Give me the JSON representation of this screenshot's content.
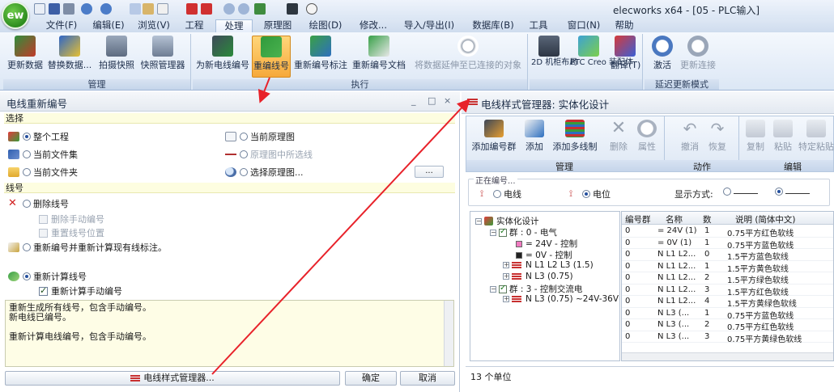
{
  "app": {
    "logo_text": "ew",
    "window_title": "elecworks x64 - [05 - PLC输入]"
  },
  "menu_tabs": [
    "文件(F)",
    "编辑(E)",
    "浏览(V)",
    "工程",
    "处理",
    "原理图",
    "绘图(D)",
    "修改...",
    "导入/导出(I)",
    "数据库(B)",
    "工具",
    "窗口(N)",
    "帮助"
  ],
  "ribbon": {
    "groups": [
      {
        "label": "管理",
        "buttons": [
          "更新数据",
          "替换数据...",
          "拍摄快照",
          "快照管理器"
        ]
      },
      {
        "label": "执行",
        "buttons": [
          "为新电线编号",
          "重编线号",
          "重新编号标注",
          "重新编号文档",
          "将数据延伸至已连接的对象"
        ]
      },
      {
        "label": "",
        "buttons": [
          "2D 机柜布局",
          "PTC Creo 装配体",
          "翻译(T)"
        ]
      },
      {
        "label": "延迟更新模式",
        "buttons": [
          "激活",
          "更新连接"
        ]
      }
    ]
  },
  "renumber_panel": {
    "title": "电线重新编号",
    "win_controls": [
      "_",
      "□",
      "×"
    ],
    "select_section": "选择",
    "scope_options": [
      "整个工程",
      "当前文件集",
      "当前文件夹"
    ],
    "scope_options_right": [
      "当前原理图",
      "原理图中所选线",
      "选择原理图..."
    ],
    "browse_label": "...",
    "wire_section": "线号",
    "delete_label": "删除线号",
    "delete_manual": "删除手动编号",
    "reset_pos": "重置线号位置",
    "renumber_recalc": "重新编号并重新计算现有线标注。",
    "recalc_label": "重新计算线号",
    "recalc_manual": "重新计算手动编号",
    "description": [
      "重新生成所有线号，包含手动编号。",
      "新电线已编号。",
      "",
      "重新计算电线编号，包含手动编号。"
    ],
    "style_manager_button": "电线样式管理器...",
    "ok_button": "确定",
    "cancel_button": "取消"
  },
  "style_manager": {
    "title": "电线样式管理器: 实体化设计",
    "toolbar": {
      "groups": [
        {
          "label": "管理",
          "buttons": [
            "添加编号群",
            "添加",
            "添加多线制",
            "删除",
            "属性"
          ]
        },
        {
          "label": "动作",
          "buttons": [
            "撤消",
            "恢复"
          ]
        },
        {
          "label": "编辑",
          "buttons": [
            "复制",
            "粘贴",
            "特定粘贴"
          ]
        }
      ]
    },
    "existing_label": "正在编号...",
    "mode_wire": "电线",
    "mode_potential": "电位",
    "display_mode_label": "显示方式:",
    "tree": {
      "root": "实体化设计",
      "group0": "群 : 0 - 电气",
      "group0_items": [
        "= 24V - 控制",
        "= 0V - 控制",
        "N L1 L2 L3 (1.5)",
        "N L3 (0.75)"
      ],
      "group3": "群 : 3 - 控制交流电",
      "group3_items": [
        "N L3 (0.75) ~24V-36V"
      ]
    },
    "grid": {
      "columns": [
        "编号群",
        "名称",
        "数",
        "说明 (简体中文)"
      ],
      "rows": [
        [
          "0",
          "= 24V (1)",
          "1",
          "0.75平方红色软线"
        ],
        [
          "0",
          "= 0V (1)",
          "1",
          "0.75平方蓝色软线"
        ],
        [
          "0",
          "N L1 L2...",
          "0",
          "1.5平方蓝色软线"
        ],
        [
          "0",
          "N L1 L2...",
          "1",
          "1.5平方黄色软线"
        ],
        [
          "0",
          "N L1 L2...",
          "2",
          "1.5平方绿色软线"
        ],
        [
          "0",
          "N L1 L2...",
          "3",
          "1.5平方红色软线"
        ],
        [
          "0",
          "N L1 L2...",
          "4",
          "1.5平方黄绿色软线"
        ],
        [
          "0",
          "N L3 (...",
          "1",
          "0.75平方蓝色软线"
        ],
        [
          "0",
          "N L3 (...",
          "2",
          "0.75平方红色软线"
        ],
        [
          "0",
          "N L3 (...",
          "3",
          "0.75平方黄绿色软线"
        ]
      ]
    },
    "status": "13 个单位"
  },
  "colors": {
    "accent_red": "#e8222a",
    "active_orange": "#f6a93b",
    "panel_yellow": "#fdfde0"
  }
}
